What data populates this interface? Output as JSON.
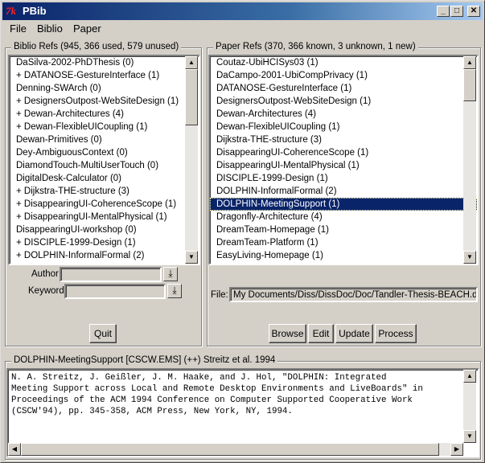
{
  "window": {
    "title": "PBib",
    "app_icon_glyph": "7k",
    "controls": {
      "minimize": "_",
      "maximize": "□",
      "close": "✕"
    }
  },
  "menubar": [
    {
      "label": "File"
    },
    {
      "label": "Biblio"
    },
    {
      "label": "Paper"
    }
  ],
  "biblio_refs": {
    "label": "Biblio Refs (945, 366 used, 579 unused)",
    "items": [
      "DaSilva-2002-PhDThesis (0)",
      "+ DATANOSE-GestureInterface (1)",
      "Denning-SWArch (0)",
      "+ DesignersOutpost-WebSiteDesign (1)",
      "+ Dewan-Architectures (4)",
      "+ Dewan-FlexibleUICoupling (1)",
      "Dewan-Primitives (0)",
      "Dey-AmbiguousContext (0)",
      "DiamondTouch-MultiUserTouch (0)",
      "DigitalDesk-Calculator (0)",
      "+ Dijkstra-THE-structure (3)",
      "+ DisappearingUI-CoherenceScope (1)",
      "+ DisappearingUI-MentalPhysical (1)",
      "DisappearingUI-workshop (0)",
      "+ DISCIPLE-1999-Design (1)",
      "+ DOLPHIN-InformalFormal (2)"
    ],
    "author_label": "Author",
    "author_value": "",
    "keyword_label": "Keyword",
    "keyword_value": "",
    "quit_label": "Quit"
  },
  "paper_refs": {
    "label": "Paper Refs (370, 366 known, 3 unknown, 1 new)",
    "items": [
      "Coutaz-UbiHCISys03 (1)",
      "DaCampo-2001-UbiCompPrivacy (1)",
      "DATANOSE-GestureInterface (1)",
      "DesignersOutpost-WebSiteDesign (1)",
      "Dewan-Architectures (4)",
      "Dewan-FlexibleUICoupling (1)",
      "Dijkstra-THE-structure (3)",
      "DisappearingUI-CoherenceScope (1)",
      "DisappearingUI-MentalPhysical (1)",
      "DISCIPLE-1999-Design (1)",
      "DOLPHIN-InformalFormal (2)",
      "DOLPHIN-MeetingSupport (1)",
      "Dragonfly-Architecture (4)",
      "DreamTeam-Homepage (1)",
      "DreamTeam-Platform (1)",
      "EasyLiving-Homepage (1)"
    ],
    "selected_index": 11,
    "file_label": "File:",
    "file_value": "My Documents/Diss/DissDoc/Doc/Tandler-Thesis-BEACH.doc",
    "buttons": {
      "browse": "Browse",
      "edit": "Edit",
      "update": "Update",
      "process": "Process"
    }
  },
  "detail": {
    "label": "DOLPHIN-MeetingSupport [CSCW.EMS] (++) Streitz et al. 1994",
    "lines": [
      "N. A. Streitz, J. Geißler, J. M. Haake, and J. Hol, \"DOLPHIN: Integrated",
      "Meeting Support across Local and Remote Desktop Environments and LiveBoards\" in",
      "Proceedings of the ACM 1994 Conference on Computer Supported Cooperative Work",
      "(CSCW'94), pp. 345-358, ACM Press, New York, NY, 1994."
    ]
  },
  "scroll_glyphs": {
    "up": "▲",
    "down": "▼",
    "left": "◀",
    "right": "▶",
    "download": "⤓"
  }
}
